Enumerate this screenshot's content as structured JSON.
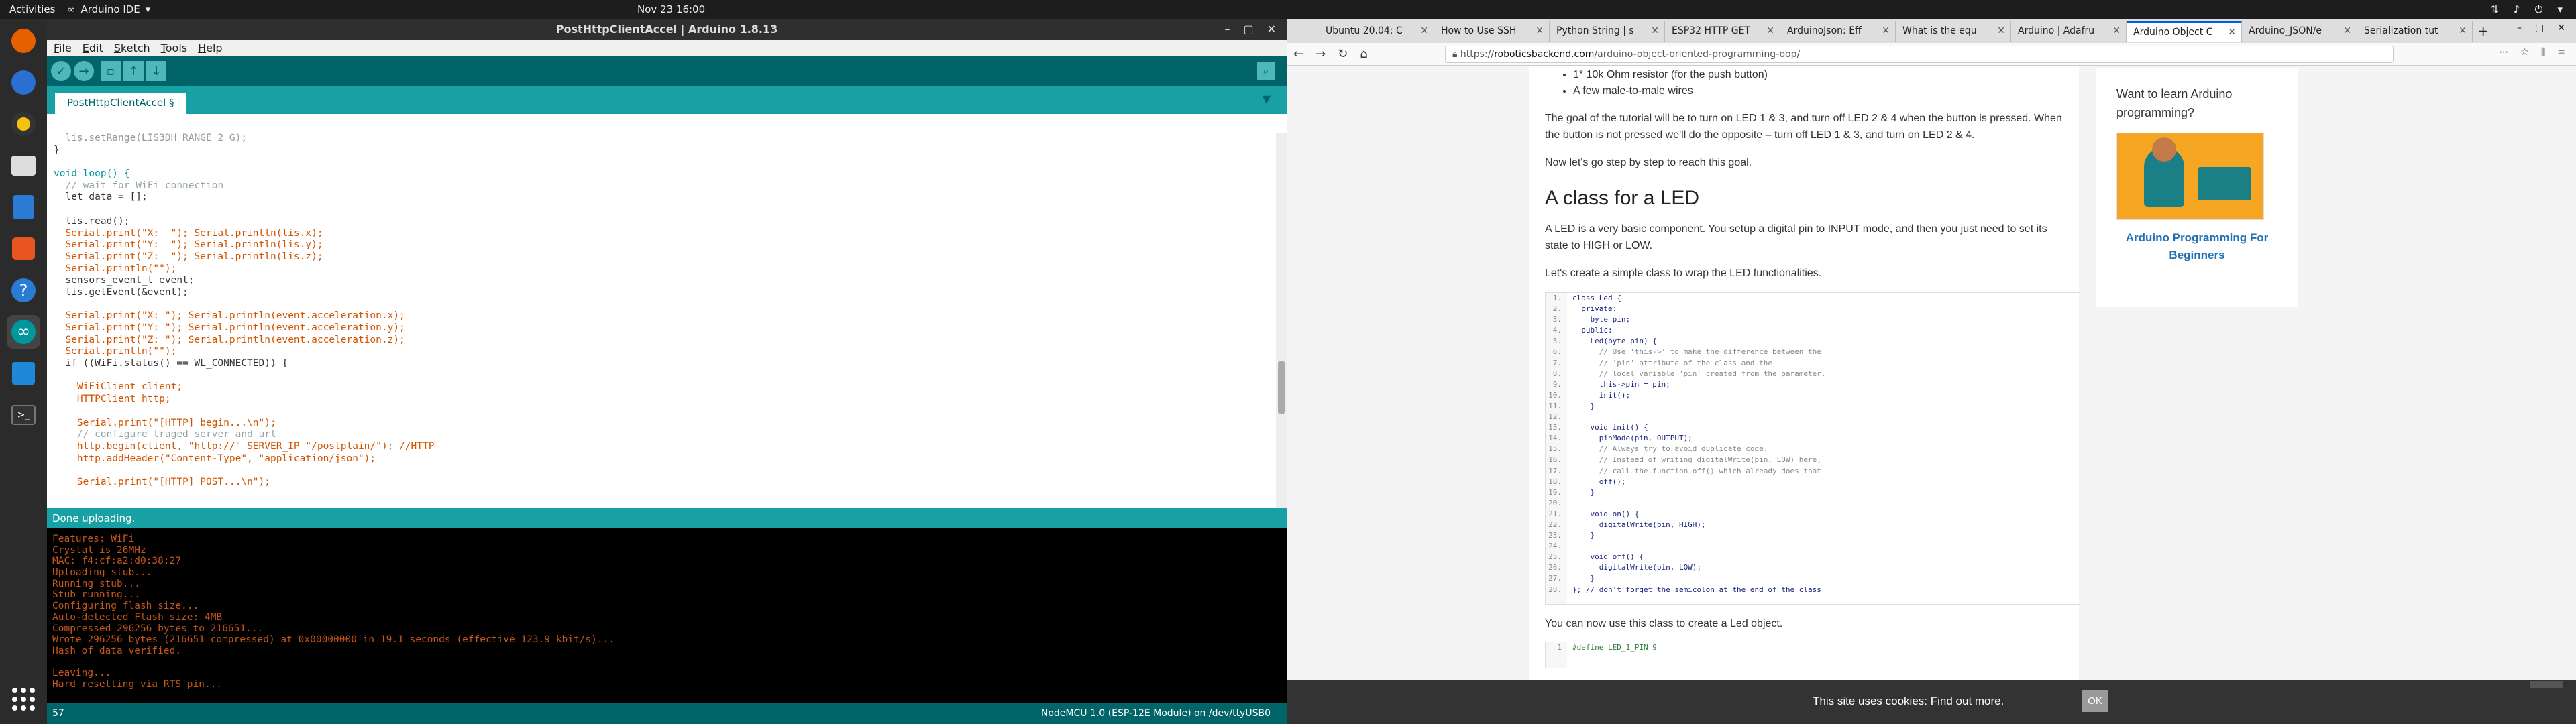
{
  "topbar": {
    "activities": "Activities",
    "app_name": "Arduino IDE",
    "clock": "Nov 23  16:00"
  },
  "arduino": {
    "title": "PostHttpClientAccel | Arduino 1.8.13",
    "menu": [
      "File",
      "Edit",
      "Sketch",
      "Tools",
      "Help"
    ],
    "tab": "PostHttpClientAccel §",
    "code": [
      {
        "t": "  lis.setRange(LIS3DH_RANGE_2_G);",
        "c": "#999"
      },
      {
        "t": "}",
        "c": "#333"
      },
      {
        "t": "",
        "c": "#333"
      },
      {
        "t": "void loop() {",
        "c": "#00979c"
      },
      {
        "t": "  // wait for WiFi connection",
        "c": "#95a5a6"
      },
      {
        "t": "  let data = [];",
        "c": "#333"
      },
      {
        "t": "",
        "c": "#333"
      },
      {
        "t": "  lis.read();",
        "c": "#333"
      },
      {
        "t": "  Serial.print(\"X:  \"); Serial.println(lis.x);",
        "c": "#d35400"
      },
      {
        "t": "  Serial.print(\"Y:  \"); Serial.println(lis.y);",
        "c": "#d35400"
      },
      {
        "t": "  Serial.print(\"Z:  \"); Serial.println(lis.z);",
        "c": "#d35400"
      },
      {
        "t": "  Serial.println(\"\");",
        "c": "#d35400"
      },
      {
        "t": "  sensors_event_t event;",
        "c": "#333"
      },
      {
        "t": "  lis.getEvent(&event);",
        "c": "#333"
      },
      {
        "t": "",
        "c": "#333"
      },
      {
        "t": "  Serial.print(\"X: \"); Serial.println(event.acceleration.x);",
        "c": "#d35400"
      },
      {
        "t": "  Serial.print(\"Y: \"); Serial.println(event.acceleration.y);",
        "c": "#d35400"
      },
      {
        "t": "  Serial.print(\"Z: \"); Serial.println(event.acceleration.z);",
        "c": "#d35400"
      },
      {
        "t": "  Serial.println(\"\");",
        "c": "#d35400"
      },
      {
        "t": "  if ((WiFi.status() == WL_CONNECTED)) {",
        "c": "#333"
      },
      {
        "t": "",
        "c": "#333"
      },
      {
        "t": "    WiFiClient client;",
        "c": "#d35400"
      },
      {
        "t": "    HTTPClient http;",
        "c": "#d35400"
      },
      {
        "t": "",
        "c": "#333"
      },
      {
        "t": "    Serial.print(\"[HTTP] begin...\\n\");",
        "c": "#d35400"
      },
      {
        "t": "    // configure traged server and url",
        "c": "#95a5a6"
      },
      {
        "t": "    http.begin(client, \"http://\" SERVER_IP \"/postplain/\"); //HTTP",
        "c": "#d35400"
      },
      {
        "t": "    http.addHeader(\"Content-Type\", \"application/json\");",
        "c": "#d35400"
      },
      {
        "t": "",
        "c": "#333"
      },
      {
        "t": "    Serial.print(\"[HTTP] POST...\\n\");",
        "c": "#d35400"
      }
    ],
    "status": "Done uploading.",
    "console": [
      "Features: WiFi",
      "Crystal is 26MHz",
      "MAC: f4:cf:a2:d0:38:27",
      "Uploading stub...",
      "Running stub...",
      "Stub running...",
      "Configuring flash size...",
      "Auto-detected Flash size: 4MB",
      "Compressed 296256 bytes to 216651...",
      "Wrote 296256 bytes (216651 compressed) at 0x00000000 in 19.1 seconds (effective 123.9 kbit/s)...",
      "Hash of data verified.",
      "",
      "Leaving...",
      "Hard resetting via RTS pin..."
    ],
    "line_no": "57",
    "board": "NodeMCU 1.0 (ESP-12E Module) on /dev/ttyUSB0"
  },
  "firefox": {
    "tabs": [
      "Ubuntu 20.04: C",
      "How to Use SSH",
      "Python String | s",
      "ESP32 HTTP GET",
      "ArduinoJson: Eff",
      "What is the equ",
      "Arduino | Adafru",
      "Arduino Object C",
      "Arduino_JSON/e",
      "Serialization tut"
    ],
    "selected_tab": 7,
    "url_prefix": "https://",
    "url_domain": "roboticsbackend.com",
    "url_path": "/arduino-object-oriented-programming-oop/",
    "bullets": [
      "1* 10k Ohm resistor (for the push button)",
      "A few male-to-male wires"
    ],
    "p1": "The goal of the tutorial will be to turn on LED 1 & 3, and turn off LED 2 & 4 when the button is pressed. When the button is not pressed we'll do the opposite – turn off LED 1 & 3, and turn on LED 2 & 4.",
    "p2": "Now let's go step by step to reach this goal.",
    "h2": "A class for a LED",
    "p3": "A LED is a very basic component. You setup a digital pin to INPUT mode, and then you just need to set its state to HIGH or LOW.",
    "p4": "Let's create a simple class to wrap the LED functionalities.",
    "code_lines": [
      "class Led {",
      "  private:",
      "    byte pin;",
      "  public:",
      "    Led(byte pin) {",
      "      // Use 'this->' to make the difference between the",
      "      // 'pin' attribute of the class and the",
      "      // local variable 'pin' created from the parameter.",
      "      this->pin = pin;",
      "      init();",
      "    }",
      "",
      "    void init() {",
      "      pinMode(pin, OUTPUT);",
      "      // Always try to avoid duplicate code.",
      "      // Instead of writing digitalWrite(pin, LOW) here,",
      "      // call the function off() which already does that",
      "      off();",
      "    }",
      "",
      "    void on() {",
      "      digitalWrite(pin, HIGH);",
      "    }",
      "",
      "    void off() {",
      "      digitalWrite(pin, LOW);",
      "    }",
      "}; // don't forget the semicolon at the end of the class"
    ],
    "p5": "You can now use this class to create a Led object.",
    "code2_line": "#define LED_1_PIN 9",
    "sidebar_title": "Want to learn Arduino programming?",
    "sidebar_link": "Arduino Programming For Beginners",
    "cookie_text": "This site uses cookies: Find out more.",
    "cookie_ok": "OK"
  }
}
